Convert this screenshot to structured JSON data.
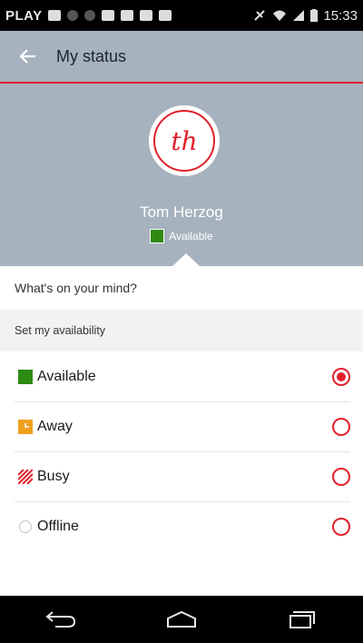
{
  "statusbar": {
    "carrier": "PLAY",
    "time": "15:33"
  },
  "toolbar": {
    "title": "My status"
  },
  "profile": {
    "initials": "th",
    "name": "Tom Herzog",
    "status_text": "Available"
  },
  "mind": {
    "placeholder": "What's on your mind?"
  },
  "availability": {
    "header": "Set my availability",
    "options": [
      {
        "label": "Available",
        "selected": true,
        "icon": "available-icon",
        "color": "#2f8a14"
      },
      {
        "label": "Away",
        "selected": false,
        "icon": "away-icon",
        "color": "#f0a020"
      },
      {
        "label": "Busy",
        "selected": false,
        "icon": "busy-icon",
        "color": "#e2202b"
      },
      {
        "label": "Offline",
        "selected": false,
        "icon": "offline-icon",
        "color": "#cccccc"
      }
    ]
  },
  "colors": {
    "accent": "#e2202b",
    "header_bg": "#a7b2bf"
  }
}
